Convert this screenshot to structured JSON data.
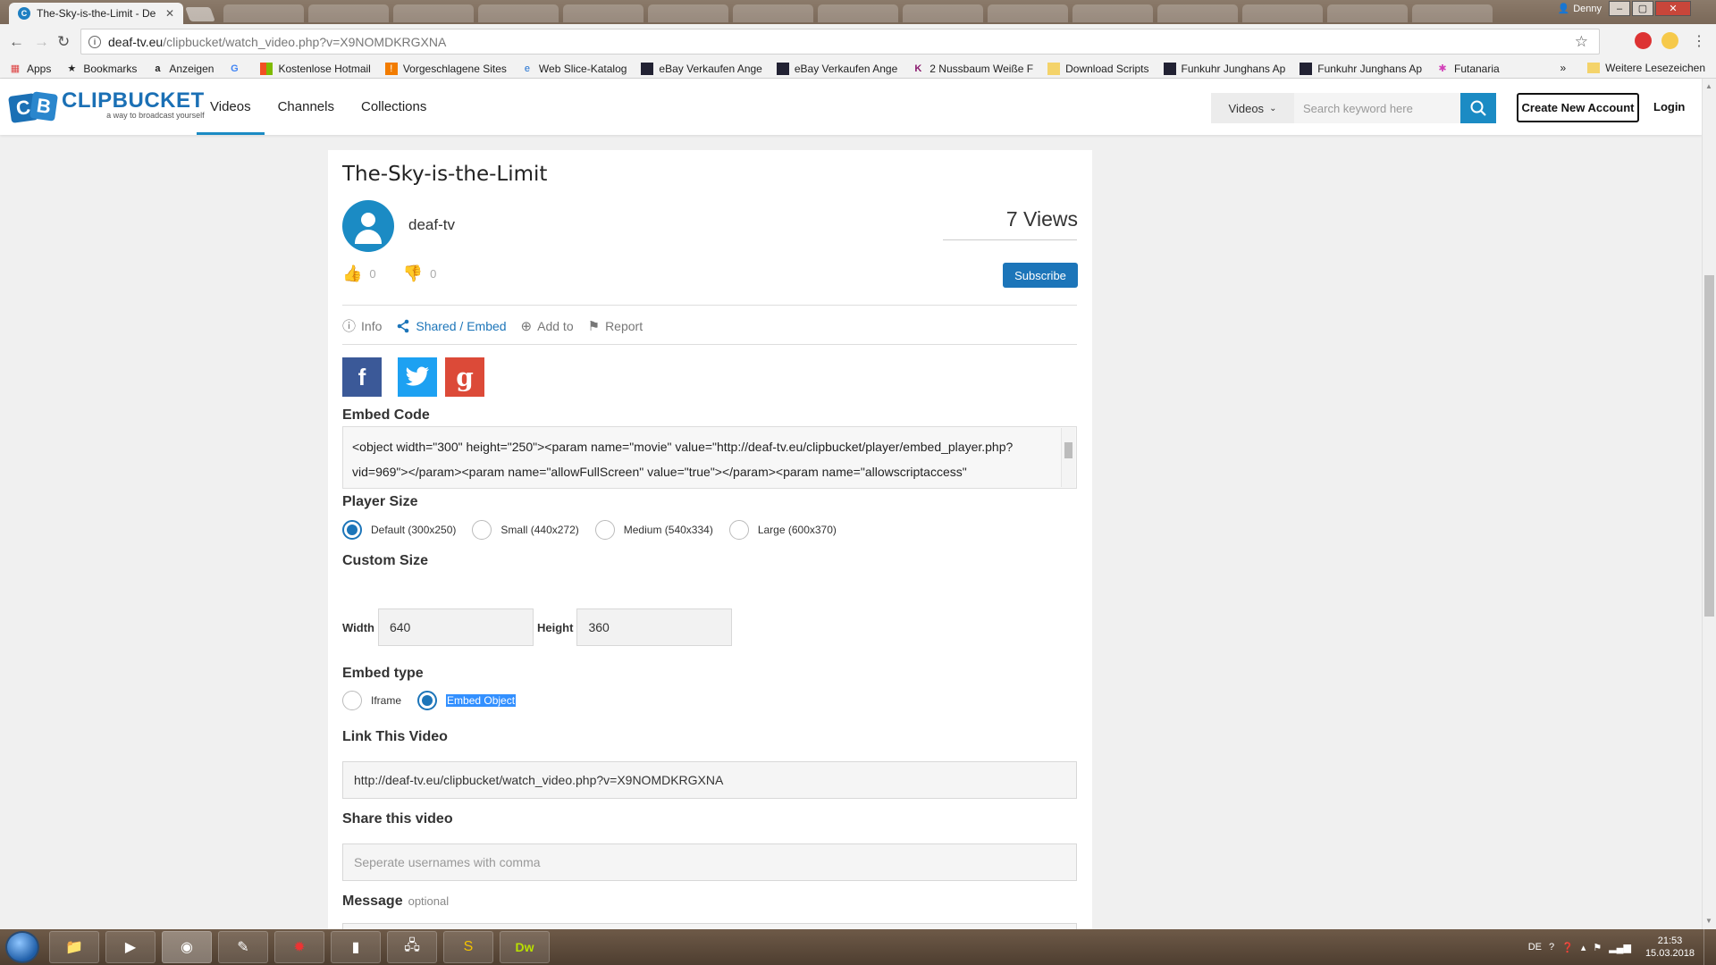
{
  "browser": {
    "active_tab": "The-Sky-is-the-Limit - De",
    "window_user": "Denny",
    "url_host": "deaf-tv.eu",
    "url_path": "/clipbucket/watch_video.php?v=X9NOMDKRGXNA",
    "bookmarks": [
      {
        "label": "Apps",
        "icon": "apps-grid-icon"
      },
      {
        "label": "Bookmarks",
        "icon": "star-icon"
      },
      {
        "label": "Anzeigen",
        "icon": "amazon-icon"
      },
      {
        "label": "",
        "icon": "google-icon"
      },
      {
        "label": "Kostenlose Hotmail",
        "icon": "windows-icon"
      },
      {
        "label": "Vorgeschlagene Sites",
        "icon": "ie-icon"
      },
      {
        "label": "Web Slice-Katalog",
        "icon": "ie-icon"
      },
      {
        "label": "eBay Verkaufen Ange",
        "icon": "tv-icon"
      },
      {
        "label": "eBay Verkaufen Ange",
        "icon": "tv-icon"
      },
      {
        "label": "2 Nussbaum Weiße F",
        "icon": "k-icon"
      },
      {
        "label": "Download Scripts",
        "icon": "folder-icon"
      },
      {
        "label": "Funkuhr Junghans Ap",
        "icon": "tv-icon"
      },
      {
        "label": "Funkuhr Junghans Ap",
        "icon": "tv-icon"
      },
      {
        "label": "Futanaria",
        "icon": "puzzle-icon"
      }
    ],
    "bookmarks_more": "»",
    "other_bookmarks": "Weitere Lesezeichen"
  },
  "site": {
    "logo_name": "CLIPBUCKET",
    "logo_tagline": "a way to broadcast yourself",
    "nav": [
      "Videos",
      "Channels",
      "Collections"
    ],
    "search_type": "Videos",
    "search_placeholder": "Search keyword here",
    "create_account": "Create New Account",
    "login": "Login"
  },
  "video": {
    "title": "The-Sky-is-the-Limit",
    "channel": "deaf-tv",
    "views": "7 Views",
    "likes": "0",
    "dislikes": "0",
    "subscribe": "Subscribe"
  },
  "tabs": [
    {
      "label": "Info",
      "icon": "info-icon"
    },
    {
      "label": "Shared / Embed",
      "icon": "share-icon"
    },
    {
      "label": "Add to",
      "icon": "plus-circle-icon"
    },
    {
      "label": "Report",
      "icon": "flag-icon"
    }
  ],
  "share": {
    "embed_code_label": "Embed Code",
    "embed_code": "<object width=\"300\" height=\"250\"><param name=\"movie\" value=\"http://deaf-tv.eu/clipbucket/player/embed_player.php?vid=969\"></param><param name=\"allowFullScreen\" value=\"true\"></param><param name=\"allowscriptaccess\"",
    "player_size_label": "Player Size",
    "player_sizes": [
      "Default (300x250)",
      "Small (440x272)",
      "Medium (540x334)",
      "Large (600x370)"
    ],
    "player_size_selected": "Default (300x250)",
    "custom_size_label": "Custom Size",
    "width_label": "Width",
    "width_value": "640",
    "height_label": "Height",
    "height_value": "360",
    "embed_type_label": "Embed type",
    "embed_types": [
      "Iframe",
      "Embed Object"
    ],
    "embed_type_selected": "Embed Object",
    "link_label": "Link This Video",
    "link_value": "http://deaf-tv.eu/clipbucket/watch_video.php?v=X9NOMDKRGXNA",
    "share_label": "Share this video",
    "share_placeholder": "Seperate usernames with comma",
    "message_label": "Message",
    "message_optional": "optional"
  },
  "social_colors": {
    "facebook": "#3b5998",
    "twitter": "#1da1f2",
    "google": "#dc4a38"
  },
  "taskbar": {
    "lang": "DE",
    "time": "21:53",
    "date": "15.03.2018"
  }
}
